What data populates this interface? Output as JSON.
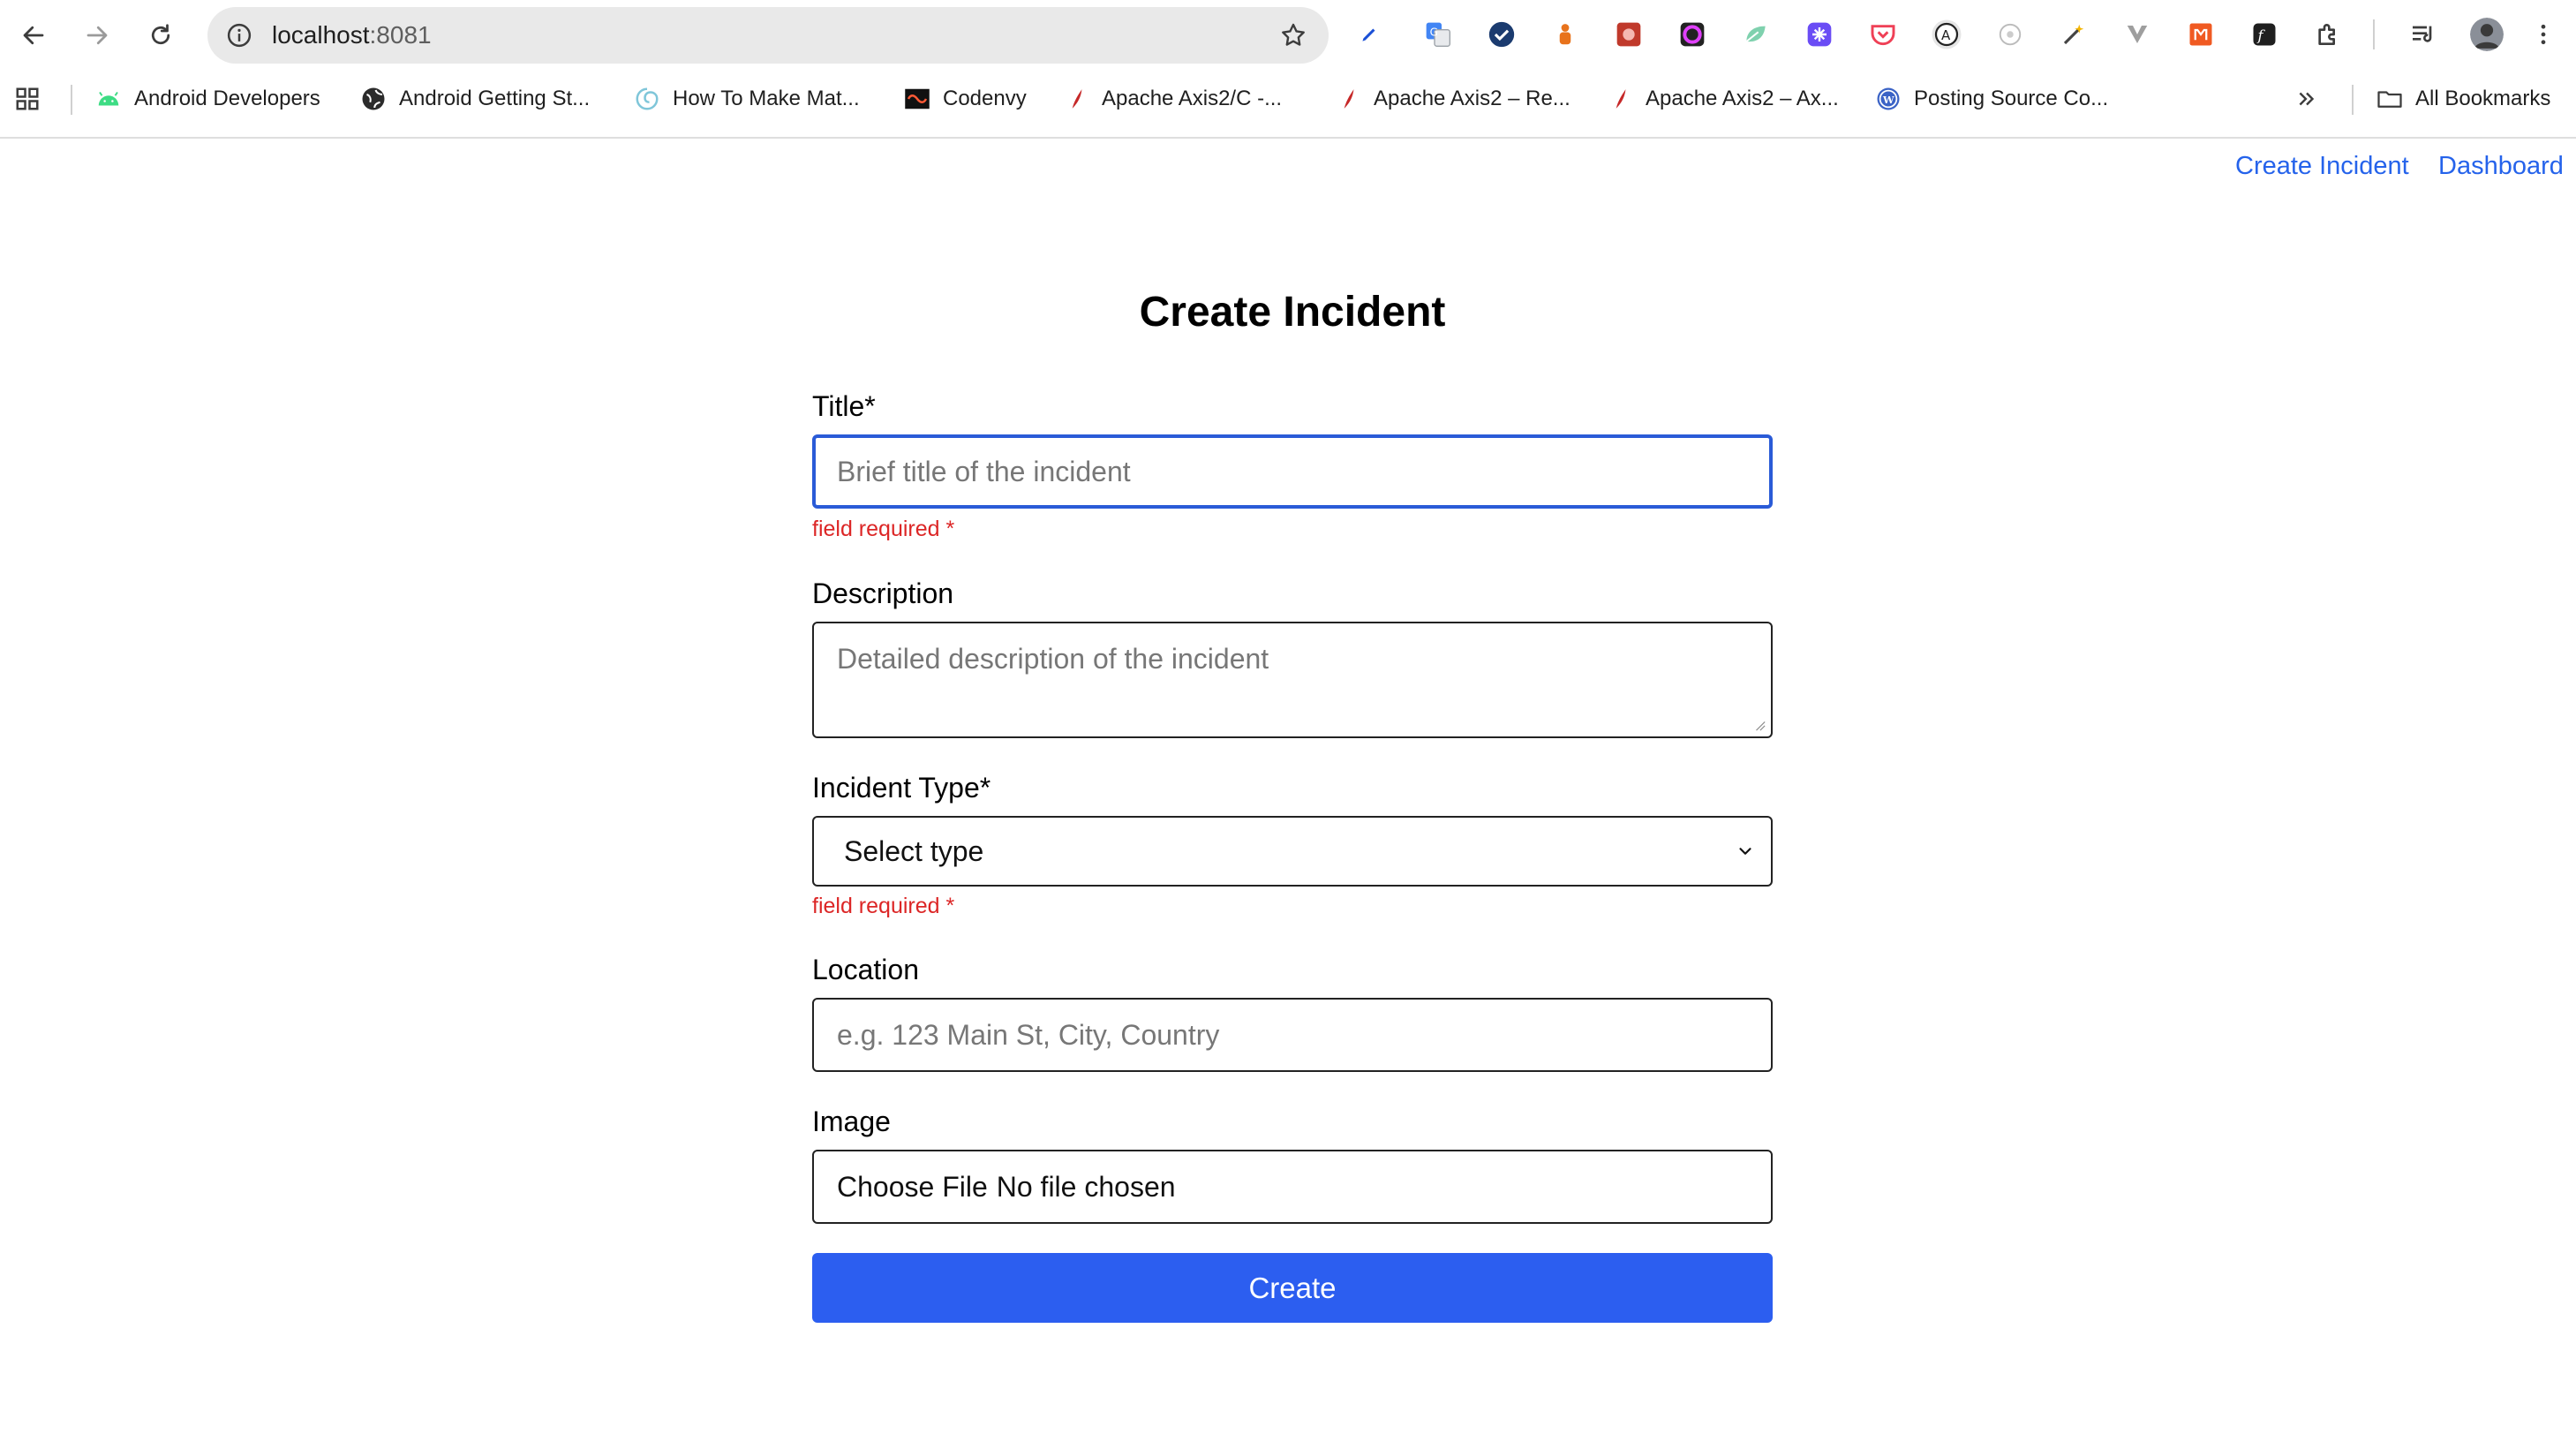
{
  "browser": {
    "url_host": "localhost",
    "url_port": ":8081",
    "bookmarks": [
      {
        "label": "Android Developers",
        "icon": "android-icon"
      },
      {
        "label": "Android Getting St...",
        "icon": "globe-icon"
      },
      {
        "label": "How To Make Mat...",
        "icon": "swirl-icon"
      },
      {
        "label": "Codenvy",
        "icon": "codenvy-icon"
      },
      {
        "label": "Apache Axis2/C -...",
        "icon": "apache-feather-icon"
      },
      {
        "label": "Apache Axis2 – Re...",
        "icon": "apache-feather-icon"
      },
      {
        "label": "Apache Axis2 – Ax...",
        "icon": "apache-feather-icon"
      },
      {
        "label": "Posting Source Co...",
        "icon": "wordpress-icon"
      }
    ],
    "all_bookmarks_label": "All Bookmarks"
  },
  "nav": {
    "create_incident": "Create Incident",
    "dashboard": "Dashboard"
  },
  "form": {
    "title": "Create Incident",
    "title_label": "Title*",
    "title_placeholder": "Brief title of the incident",
    "title_error": "field required *",
    "description_label": "Description",
    "description_placeholder": "Detailed description of the incident",
    "type_label": "Incident Type*",
    "type_selected": "Select type",
    "type_error": "field required *",
    "location_label": "Location",
    "location_placeholder": "e.g. 123 Main St, City, Country",
    "image_label": "Image",
    "file_button": "Choose File",
    "file_status": "No file chosen",
    "submit": "Create"
  },
  "colors": {
    "accent": "#2c5ef0",
    "link": "#2563eb",
    "error": "#dc2626",
    "focus_border": "#2a5bd7"
  }
}
